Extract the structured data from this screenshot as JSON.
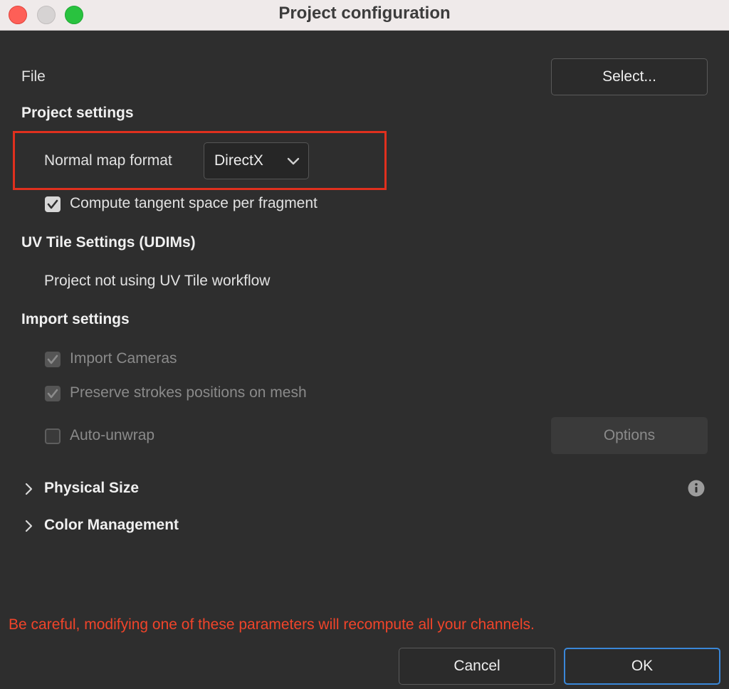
{
  "window": {
    "title": "Project configuration"
  },
  "file": {
    "label": "File",
    "select_button": "Select..."
  },
  "project_settings": {
    "header": "Project settings",
    "normal_map_label": "Normal map format",
    "normal_map_value": "DirectX",
    "tangent_checkbox": {
      "label": "Compute tangent space per fragment",
      "checked": true
    }
  },
  "uv_tile": {
    "header": "UV Tile Settings (UDIMs)",
    "status": "Project not using UV Tile workflow"
  },
  "import_settings": {
    "header": "Import settings",
    "import_cameras": {
      "label": "Import Cameras",
      "checked": true,
      "enabled": false
    },
    "preserve_strokes": {
      "label": "Preserve strokes positions on mesh",
      "checked": true,
      "enabled": false
    },
    "auto_unwrap": {
      "label": "Auto-unwrap",
      "checked": false,
      "enabled": false
    },
    "options_button": "Options"
  },
  "sections": {
    "physical_size": "Physical Size",
    "color_management": "Color Management"
  },
  "warning": "Be careful, modifying one of these parameters will recompute all your channels.",
  "footer": {
    "cancel": "Cancel",
    "ok": "OK"
  },
  "colors": {
    "accent": "#3a87d8",
    "warning": "#f0442a",
    "highlight": "#e0301e"
  }
}
